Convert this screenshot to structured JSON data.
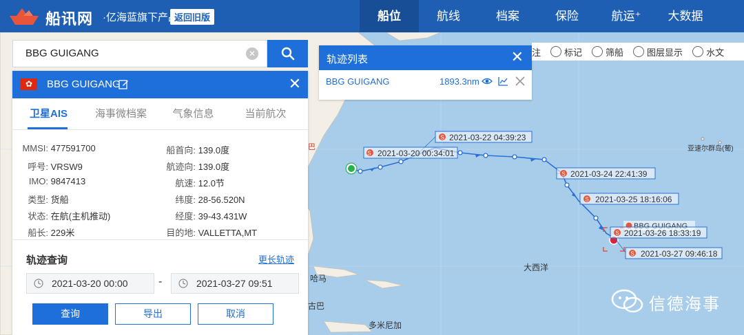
{
  "brand": {
    "name": "船讯网",
    "sub": "·亿海蓝旗下产品 |",
    "old_version": "返回旧版"
  },
  "nav": [
    {
      "label": "船位",
      "active": true
    },
    {
      "label": "航线",
      "active": false
    },
    {
      "label": "档案",
      "active": false
    },
    {
      "label": "保险",
      "active": false
    },
    {
      "label": "航运⁺",
      "active": false
    },
    {
      "label": "大数据",
      "active": false
    }
  ],
  "search": {
    "value": "BBG GUIGANG"
  },
  "ship": {
    "name": "BBG GUIGANG",
    "tabs": [
      "卫星AIS",
      "海事微档案",
      "气象信息",
      "当前航次"
    ],
    "info_left": [
      {
        "label": "MMSI:",
        "value": "477591700"
      },
      {
        "label": "呼号:",
        "value": "VRSW9"
      },
      {
        "label": "IMO:",
        "value": "9847413"
      },
      {
        "label": "类型:",
        "value": "货船"
      },
      {
        "label": "状态:",
        "value": "在航(主机推动)"
      },
      {
        "label": "船长:",
        "value": "229米"
      }
    ],
    "info_right": [
      {
        "label": "船首向:",
        "value": "139.0度"
      },
      {
        "label": "航迹向:",
        "value": "139.0度"
      },
      {
        "label": "航速:",
        "value": "12.0节"
      },
      {
        "label": "纬度:",
        "value": "28-56.520N"
      },
      {
        "label": "经度:",
        "value": "39-43.431W"
      },
      {
        "label": "目的地:",
        "value": "VALLETTA,MT"
      }
    ]
  },
  "track_query": {
    "title": "轨迹查询",
    "longer_link": "更长轨迹",
    "start": "2021-03-20 00:00",
    "end": "2021-03-27 09:51",
    "dash": "-",
    "query_btn": "查询",
    "export_btn": "导出",
    "cancel_btn": "取消"
  },
  "track_list": {
    "title": "轨迹列表",
    "ship": "BBG GUIGANG",
    "distance": "1893.3nm"
  },
  "toolbar": [
    {
      "label": "注",
      "icon": "note-icon"
    },
    {
      "label": "标记",
      "icon": "tag-icon"
    },
    {
      "label": "筛船",
      "icon": "filter-icon"
    },
    {
      "label": "图层显示",
      "icon": "layers-icon"
    },
    {
      "label": "水文",
      "icon": "water-icon"
    }
  ],
  "map": {
    "labels": {
      "azores": "亚速尔群岛(葡)",
      "atlantic": "大西洋",
      "caribbean1": "哈马",
      "caribbean2": "古巴",
      "dominica": "多米尼加",
      "edge": "巴"
    },
    "ship_label": "BBG GUIGANG",
    "track_points": [
      {
        "label": "2021-03-20 00:34:01"
      },
      {
        "label": "2021-03-22 04:39:23"
      },
      {
        "label": "2021-03-24 22:41:39"
      },
      {
        "label": "2021-03-25 18:16:06"
      },
      {
        "label": "2021-03-26 18:33:19"
      },
      {
        "label": "2021-03-27 09:46:18"
      }
    ]
  },
  "watermark": "信德海事",
  "colors": {
    "primary": "#1e6fd9",
    "nav": "#1e5fb4",
    "sea": "#a8cdea",
    "land": "#f3efe6",
    "track": "#2a6fd4",
    "marker": "#e8553a"
  }
}
